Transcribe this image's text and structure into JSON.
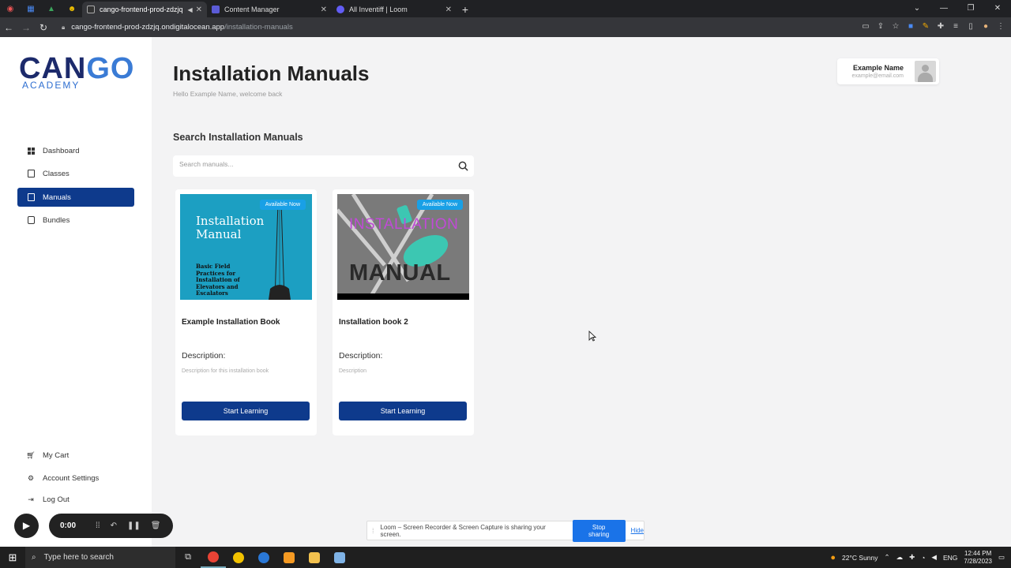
{
  "browser": {
    "tabs": [
      {
        "title": "cango-frontend-prod-zdzjq",
        "active": true
      },
      {
        "title": "Content Manager",
        "active": false
      },
      {
        "title": "All Inventiff | Loom",
        "active": false
      }
    ],
    "url_host": "cango-frontend-prod-zdzjq.ondigitalocean.app",
    "url_path": "/installation-manuals"
  },
  "logo": {
    "big_left": "CAN",
    "big_right": "GO",
    "small": "ACADEMY"
  },
  "sidebar": {
    "items": [
      {
        "label": "Dashboard",
        "icon": "grid-icon"
      },
      {
        "label": "Classes",
        "icon": "book-icon"
      },
      {
        "label": "Manuals",
        "icon": "book-icon",
        "active": true
      },
      {
        "label": "Bundles",
        "icon": "stack-icon"
      }
    ],
    "bottom": [
      {
        "label": "My Cart",
        "icon": "cart-icon"
      },
      {
        "label": "Account Settings",
        "icon": "gear-icon"
      },
      {
        "label": "Log Out",
        "icon": "logout-icon"
      }
    ]
  },
  "page": {
    "title": "Installation Manuals",
    "welcome": "Hello Example Name, welcome back",
    "search_title": "Search Installation Manuals",
    "search_placeholder": "Search manuals..."
  },
  "profile": {
    "name": "Example Name",
    "email": "example@email.com"
  },
  "cards": [
    {
      "badge": "Available Now",
      "image_title": "Installation Manual",
      "image_subtitle": "Basic Field Practices for Installation of Elevators and Escalators",
      "title": "Example Installation Book",
      "desc_label": "Description:",
      "desc": "Description for this installation book",
      "button": "Start Learning"
    },
    {
      "badge": "Available Now",
      "image_title": "INSTALLATION",
      "image_subtitle": "MANUAL",
      "title": "Installation book 2",
      "desc_label": "Description:",
      "desc": "Description",
      "button": "Start Learning"
    }
  ],
  "loom": {
    "time": "0:00",
    "share_text": "Loom – Screen Recorder & Screen Capture is sharing your screen.",
    "stop": "Stop sharing",
    "hide": "Hide"
  },
  "taskbar": {
    "search": "Type here to search",
    "weather": "22°C  Sunny",
    "lang": "ENG",
    "time": "12:44 PM",
    "date": "7/28/2023"
  },
  "colors": {
    "primary": "#0e3a8c",
    "badge": "#19a0e6",
    "share_button": "#1a73e8"
  }
}
